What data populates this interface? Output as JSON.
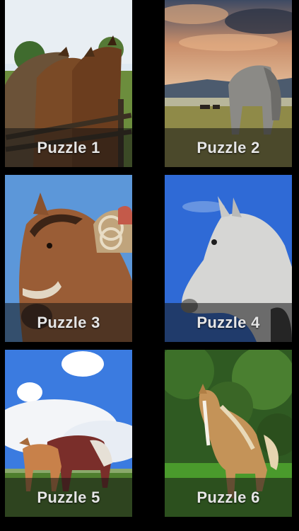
{
  "puzzles": [
    {
      "label": "Puzzle 1",
      "image": "three-horses-at-fence"
    },
    {
      "label": "Puzzle 2",
      "image": "grey-horse-grazing-sunset"
    },
    {
      "label": "Puzzle 3",
      "image": "bay-horse-with-saddle"
    },
    {
      "label": "Puzzle 4",
      "image": "grey-horse-head-blue-sky"
    },
    {
      "label": "Puzzle 5",
      "image": "mare-and-foal-meadow"
    },
    {
      "label": "Puzzle 6",
      "image": "palomino-foal-forest"
    }
  ],
  "colors": {
    "background": "#000000",
    "label_bar": "rgba(20,20,20,0.55)",
    "label_text": "#e6e6e6"
  }
}
